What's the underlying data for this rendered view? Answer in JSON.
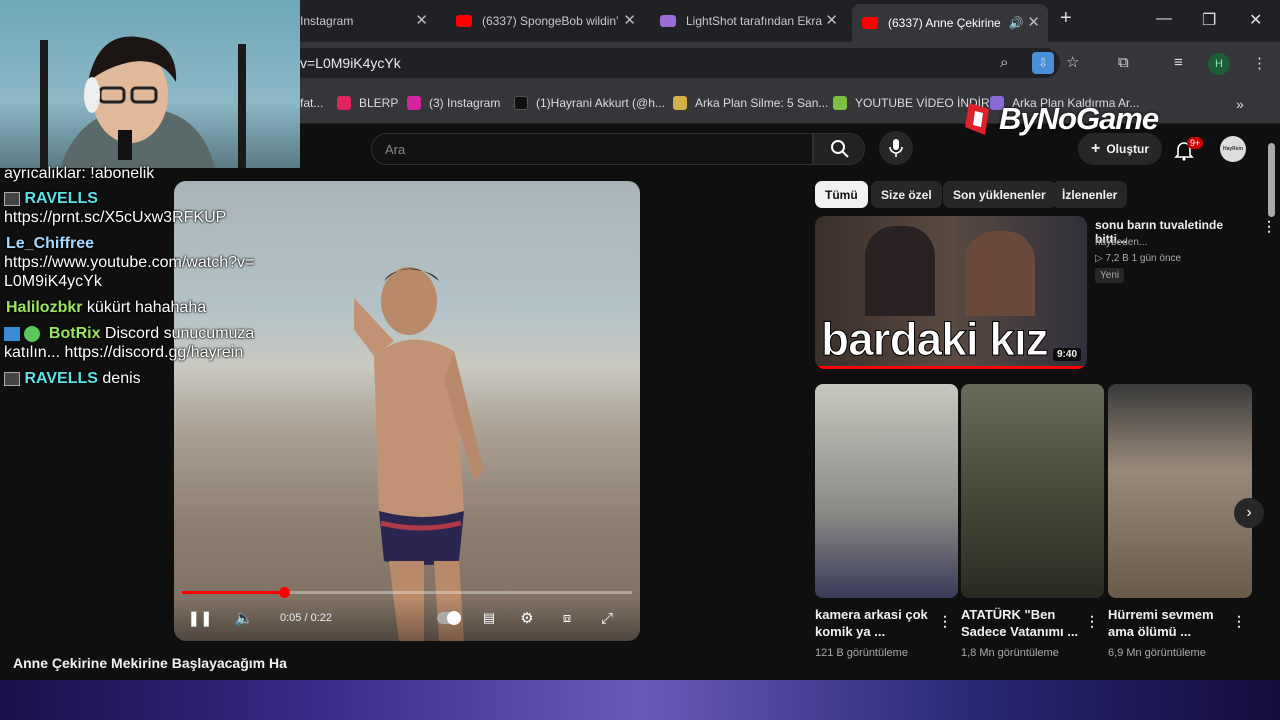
{
  "browser": {
    "tabs": [
      {
        "label": "Instagram"
      },
      {
        "label": "(6337) SpongeBob wildin'"
      },
      {
        "label": "LightShot tarafından Ekra"
      },
      {
        "label": "(6337) Anne Çekirine"
      }
    ],
    "url": "v=L0M9iK4ycYk",
    "profile_initial": "H",
    "bookmarks": [
      {
        "label": "fat..."
      },
      {
        "label": "BLERP"
      },
      {
        "label": "(3) Instagram"
      },
      {
        "label": "(1)Hayrani Akkurt (@h..."
      },
      {
        "label": "Arka Plan Silme: 5 San..."
      },
      {
        "label": "YOUTUBE VİDEO İNDİR"
      },
      {
        "label": "Arka Plan Kaldırma Ar..."
      }
    ]
  },
  "youtube": {
    "search_placeholder": "Ara",
    "create_label": "Oluştur",
    "notif_badge": "9+",
    "avatar_text": "HayRein",
    "player": {
      "time": "0:05 / 0:22",
      "progress": 0.227
    },
    "video_title": "Anne Çekirine Mekirine Başlayacağım Ha",
    "chips": [
      {
        "label": "Tümü"
      },
      {
        "label": "Size özel"
      },
      {
        "label": "Son yüklenenler"
      },
      {
        "label": "İzlenenler"
      }
    ],
    "recommended": {
      "title": "sonu barın tuvaletinde bitti...",
      "channel": "haybeden...",
      "stats": "▷ 7,2 B   1 gün önce",
      "badge": "Yeni",
      "thumb_text": "bardaki kız",
      "duration": "9:40"
    },
    "shorts": [
      {
        "title": "kamera arkasi çok komik ya ...",
        "views": "121 B görüntüleme"
      },
      {
        "title": "ATATÜRK \"Ben Sadece Vatanımı ...",
        "views": "1,8 Mn görüntüleme"
      },
      {
        "title": "Hürremi sevmem ama ölümü ...",
        "views": "6,9 Mn görüntüleme"
      }
    ]
  },
  "overlay": {
    "logo": "ByNoGame",
    "chat": [
      {
        "text": "ayrıcalıklar: !abonelik"
      },
      {
        "name": "RAVELLS",
        "message": "https://prnt.sc/X5cUxw3RFKUP",
        "color": "#5de0e6"
      },
      {
        "name": "Le_Chiffree",
        "message": "https://www.youtube.com/watch?v=L0M9iK4ycYk",
        "color": "#a8d8ff"
      },
      {
        "name": "Halilozbkr",
        "message": "kükürt hahahaha",
        "color": "#9be564"
      },
      {
        "name": "BotRix",
        "message": "Discord sunucumuza katılın... https://discord.gg/hayrein",
        "color": "#9be564"
      },
      {
        "name": "RAVELLS",
        "message": "denis",
        "color": "#5de0e6"
      }
    ]
  }
}
